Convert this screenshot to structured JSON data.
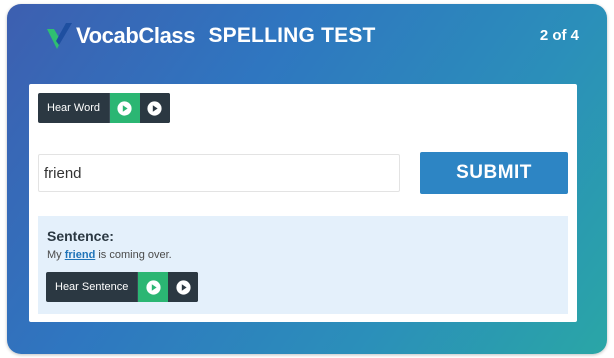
{
  "header": {
    "logo_text": "VocabClass",
    "title": "SPELLING TEST",
    "progress": "2 of 4"
  },
  "hear_word": {
    "label": "Hear Word",
    "icons": [
      "play-circle-icon",
      "play-circle-icon"
    ]
  },
  "answer": {
    "value": "friend",
    "placeholder": ""
  },
  "submit_label": "SUBMIT",
  "sentence": {
    "heading": "Sentence:",
    "before": "My ",
    "highlight": "friend",
    "after": " is coming over.",
    "hear_label": "Hear Sentence"
  },
  "colors": {
    "gradient_start": "#3d5fb0",
    "gradient_end": "#2aa6a6",
    "play_green": "#2bb673",
    "button_dark": "#2b3842",
    "submit_blue": "#2d85c4",
    "sentence_bg": "#e4f0fb",
    "highlight_blue": "#1e73b8"
  }
}
